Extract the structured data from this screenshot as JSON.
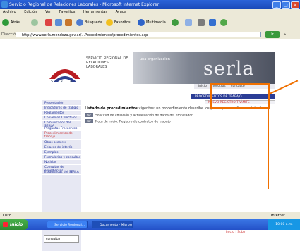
{
  "window": {
    "title": "Servicio Regional de Relaciones Laborales - Microsoft Internet Explorer",
    "controls": [
      "_",
      "□",
      "X"
    ]
  },
  "menubar": [
    "Archivo",
    "Edición",
    "Ver",
    "Favoritos",
    "Herramientas",
    "Ayuda"
  ],
  "toolbar": {
    "back": "Atrás",
    "search": "Búsqueda",
    "favorites": "Favoritos",
    "media": "Multimedia"
  },
  "address": {
    "label": "Dirección",
    "url": "http://www.serla.mendoza.gov.ar/...Procedimientos/procedimientos.asp",
    "go": "Ir",
    "links": "»"
  },
  "site": {
    "header_text": "SERVICIO REGIONAL DE RELACIONES LABORALES",
    "logo_text": "S E R L A",
    "banner_tag": "una organización",
    "banner_logo": "serla",
    "topnav": [
      "inicio",
      "nosotros",
      "contacto"
    ],
    "menu_blue": "PROCEDIMIENTOS DE TRABAJO",
    "menu_sub": "NUEVO REGISTRO TRÁMITE",
    "left_nav": [
      "Presentación",
      "Indicadores de trabajo",
      "Reglamentos",
      "Convenios Colectivos",
      "Comunicados del SERLA",
      "Preguntas Frecuentes",
      "Procedimientos de trabajo",
      "Otros sectores",
      "Enlaces de interés",
      "Ejemplos",
      "Formularios y consultas",
      "Noticias",
      "Consultas de expedientes",
      "Estadísticas del SERLA"
    ],
    "search_placeholder": "consultar",
    "list_title_bold": "Listado de procedimientos",
    "list_title_rest": " vigentes: un procedimiento describe los pasos para realizar un trámite",
    "rows": [
      {
        "tag": "PDF",
        "text": "Solicitud de afiliación y actualización de datos del empleador"
      },
      {
        "tag": "PDF",
        "text": "Nota de inicio: Registro de contratos de trabajo"
      }
    ],
    "footer_link": "Inicio  |  Subir"
  },
  "statusbar": {
    "left": "Listo",
    "right": "Internet"
  },
  "taskbar": {
    "start": "Inicio",
    "tasks": [
      "Servicio Regional...",
      "Documento - Microsoft..."
    ],
    "clock": "10:00 a.m."
  }
}
